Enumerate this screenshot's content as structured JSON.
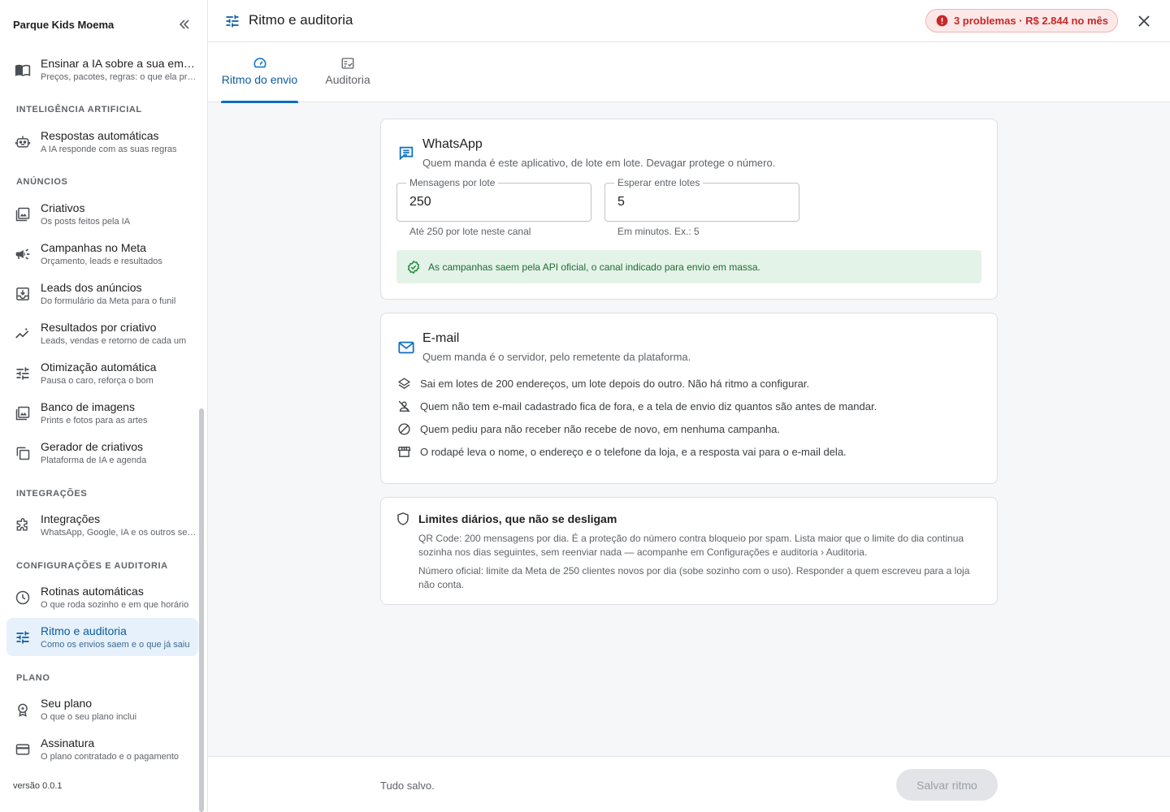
{
  "sidebar": {
    "org_name": "Parque Kids Moema",
    "top_item": {
      "title": "Ensinar a IA sobre a sua empresa",
      "sub": "Preços, pacotes, regras: o que ela precisa saber"
    },
    "sections": [
      {
        "label": "INTELIGÊNCIA ARTIFICIAL"
      },
      {
        "label": "ANÚNCIOS"
      },
      {
        "label": "INTEGRAÇÕES"
      },
      {
        "label": "CONFIGURAÇÕES E AUDITORIA"
      },
      {
        "label": "PLANO"
      }
    ],
    "items": [
      {
        "title": "Respostas automáticas",
        "sub": "A IA responde com as suas regras",
        "icon": "robot-icon"
      },
      {
        "title": "Criativos",
        "sub": "Os posts feitos pela IA",
        "icon": "image-icon"
      },
      {
        "title": "Campanhas no Meta",
        "sub": "Orçamento, leads e resultados",
        "icon": "megaphone-icon"
      },
      {
        "title": "Leads dos anúncios",
        "sub": "Do formulário da Meta para o funil",
        "icon": "inbox-download-icon"
      },
      {
        "title": "Resultados por criativo",
        "sub": "Leads, vendas e retorno de cada um",
        "icon": "trend-icon"
      },
      {
        "title": "Otimização automática",
        "sub": "Pausa o caro, reforça o bom",
        "icon": "sliders-icon"
      },
      {
        "title": "Banco de imagens",
        "sub": "Prints e fotos para as artes",
        "icon": "image-icon"
      },
      {
        "title": "Gerador de criativos",
        "sub": "Plataforma de IA e agenda",
        "icon": "copy-icon"
      },
      {
        "title": "Integrações",
        "sub": "WhatsApp, Google, IA e os outros serviços",
        "icon": "puzzle-icon"
      },
      {
        "title": "Rotinas automáticas",
        "sub": "O que roda sozinho e em que horário",
        "icon": "clock-icon"
      },
      {
        "title": "Ritmo e auditoria",
        "sub": "Como os envios saem e o que já saiu",
        "icon": "sliders-icon"
      },
      {
        "title": "Seu plano",
        "sub": "O que o seu plano inclui",
        "icon": "award-icon"
      },
      {
        "title": "Assinatura",
        "sub": "O plano contratado e o pagamento",
        "icon": "card-icon"
      }
    ],
    "version": "versão 0.0.1"
  },
  "header": {
    "title": "Ritmo e auditoria",
    "problems_badge": "3 problemas · R$ 2.844 no mês"
  },
  "tabs": [
    {
      "label": "Ritmo do envio",
      "icon": "speedometer-icon",
      "active": true
    },
    {
      "label": "Auditoria",
      "icon": "checklist-icon",
      "active": false
    }
  ],
  "whatsapp": {
    "title": "WhatsApp",
    "subtitle": "Quem manda é este aplicativo, de lote em lote. Devagar protege o número.",
    "batch_label": "Mensagens por lote",
    "batch_value": "250",
    "batch_help": "Até 250 por lote neste canal",
    "wait_label": "Esperar entre lotes",
    "wait_value": "5",
    "wait_help": "Em minutos. Ex.: 5",
    "ok_message": "As campanhas saem pela API oficial, o canal indicado para envio em massa."
  },
  "email": {
    "title": "E-mail",
    "subtitle": "Quem manda é o servidor, pelo remetente da plataforma.",
    "bullets": [
      {
        "text": "Sai em lotes de 200 endereços, um lote depois do outro. Não há ritmo a configurar.",
        "icon": "layers-icon"
      },
      {
        "text": "Quem não tem e-mail cadastrado fica de fora, e a tela de envio diz quantos são antes de mandar.",
        "icon": "person-off-icon"
      },
      {
        "text": "Quem pediu para não receber não recebe de novo, em nenhuma campanha.",
        "icon": "block-icon"
      },
      {
        "text": "O rodapé leva o nome, o endereço e o telefone da loja, e a resposta vai para o e-mail dela.",
        "icon": "store-icon"
      }
    ]
  },
  "limits": {
    "title": "Limites diários, que não se desligam",
    "p1": "QR Code: 200 mensagens por dia. É a proteção do número contra bloqueio por spam. Lista maior que o limite do dia continua sozinha nos dias seguintes, sem reenviar nada — acompanhe em Configurações e auditoria › Auditoria.",
    "p2": "Número oficial: limite da Meta de 250 clientes novos por dia (sobe sozinho com o uso). Responder a quem escreveu para a loja não conta."
  },
  "footer": {
    "status": "Tudo salvo.",
    "save_label": "Salvar ritmo"
  },
  "colors": {
    "accent": "#0b6fc4",
    "active_bg": "#e6f1fb",
    "error": "#c62828",
    "success_bg": "#e4f3e8",
    "success_text": "#1e6b34"
  }
}
